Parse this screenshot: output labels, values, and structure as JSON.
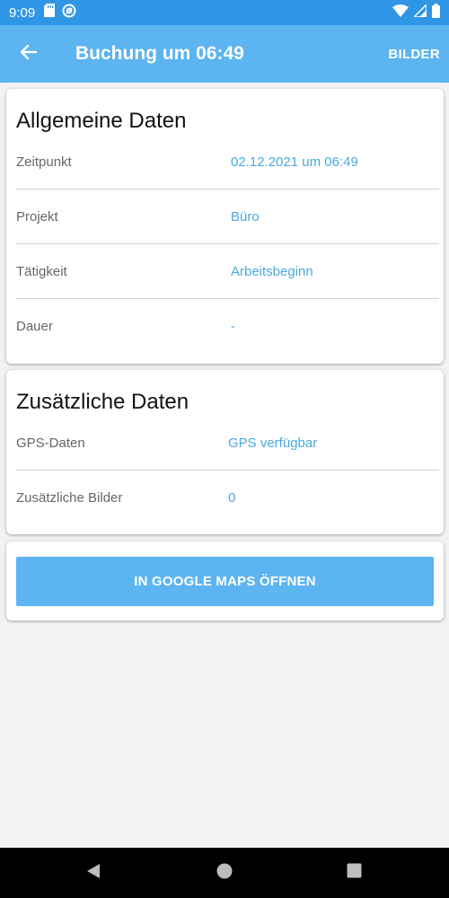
{
  "status_bar": {
    "time": "9:09",
    "icons_left": [
      "sd-card-icon",
      "sync-icon"
    ],
    "icons_right": [
      "wifi-icon",
      "signal-icon",
      "battery-icon"
    ]
  },
  "app_bar": {
    "title": "Buchung um 06:49",
    "action_label": "BILDER",
    "back_icon": "arrow-left-icon"
  },
  "general_card": {
    "title": "Allgemeine Daten",
    "rows": [
      {
        "label": "Zeitpunkt",
        "value": "02.12.2021 um 06:49"
      },
      {
        "label": "Projekt",
        "value": "Büro"
      },
      {
        "label": "Tätigkeit",
        "value": "Arbeitsbeginn"
      },
      {
        "label": "Dauer",
        "value": "-"
      }
    ]
  },
  "extra_card": {
    "title": "Zusätzliche Daten",
    "rows": [
      {
        "label": "GPS-Daten",
        "value": "GPS verfügbar"
      },
      {
        "label": "Zusätzliche Bilder",
        "value": "0"
      }
    ]
  },
  "maps_card": {
    "button_label": "IN GOOGLE MAPS ÖFFNEN"
  },
  "nav_bar": {
    "buttons": [
      "back-triangle-icon",
      "home-circle-icon",
      "recents-square-icon"
    ]
  },
  "colors": {
    "status_bar": "#2f96e6",
    "app_bar": "#5cb4f0",
    "value_text": "#4aa8e0",
    "background": "#f2f2f3"
  }
}
